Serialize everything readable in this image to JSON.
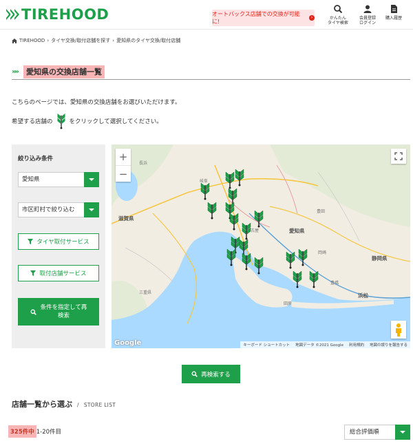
{
  "header": {
    "logo": "TIREHOOD",
    "promo": "オートバックス店舗での交換が可能に!",
    "nav": [
      {
        "label1": "かんたん",
        "label2": "タイヤ検索",
        "icon": "search-icon"
      },
      {
        "label1": "会員登録",
        "label2": "ログイン",
        "icon": "user-icon"
      },
      {
        "label1": "購入履歴",
        "label2": "",
        "icon": "document-icon"
      }
    ]
  },
  "breadcrumb": [
    "TIREHOOD",
    "タイヤ交換/取付店舗を探す",
    "愛知県のタイヤ交換/取付店舗"
  ],
  "page": {
    "title": "愛知県の交換店舗一覧",
    "intro1": "こちらのページでは、愛知県の交換店舗をお選びいただけます。",
    "intro2_before": "希望する店舗の",
    "intro2_after": "をクリックして選択してください。"
  },
  "filter": {
    "title": "絞り込み条件",
    "prefecture": "愛知県",
    "city": "市区町村で絞り込む",
    "service1": "タイヤ取付サービス",
    "service2": "取付店舗サービス",
    "condition_btn_line1": "条件を指定して再",
    "condition_btn_line2": "検索"
  },
  "map": {
    "labels": [
      {
        "text": "滋賀県"
      },
      {
        "text": "愛知県"
      },
      {
        "text": "静岡県"
      },
      {
        "text": "浜松"
      },
      {
        "text": "名古屋"
      },
      {
        "text": "田原"
      },
      {
        "text": "三重県"
      },
      {
        "text": "長浜"
      },
      {
        "text": "岐阜"
      },
      {
        "text": "豊田"
      },
      {
        "text": "岡崎"
      },
      {
        "text": "豊橋"
      }
    ],
    "footer": [
      "キーボード ショートカット",
      "地図データ ©2021 Google",
      "利用規約",
      "地図の誤りを報告する"
    ],
    "google": "Google"
  },
  "research_btn": "再検索する",
  "store_list": {
    "title": "店舗一覧から選ぶ",
    "sep": "/",
    "subtitle": "STORE LIST",
    "count": "325件中",
    "range": "1-20件目",
    "sort": "総合評価順"
  },
  "colors": {
    "brand": "#1ea04a",
    "highlight": "#f7b5b5",
    "promo_bg": "#fde3e3",
    "promo_text": "#e2231a"
  }
}
